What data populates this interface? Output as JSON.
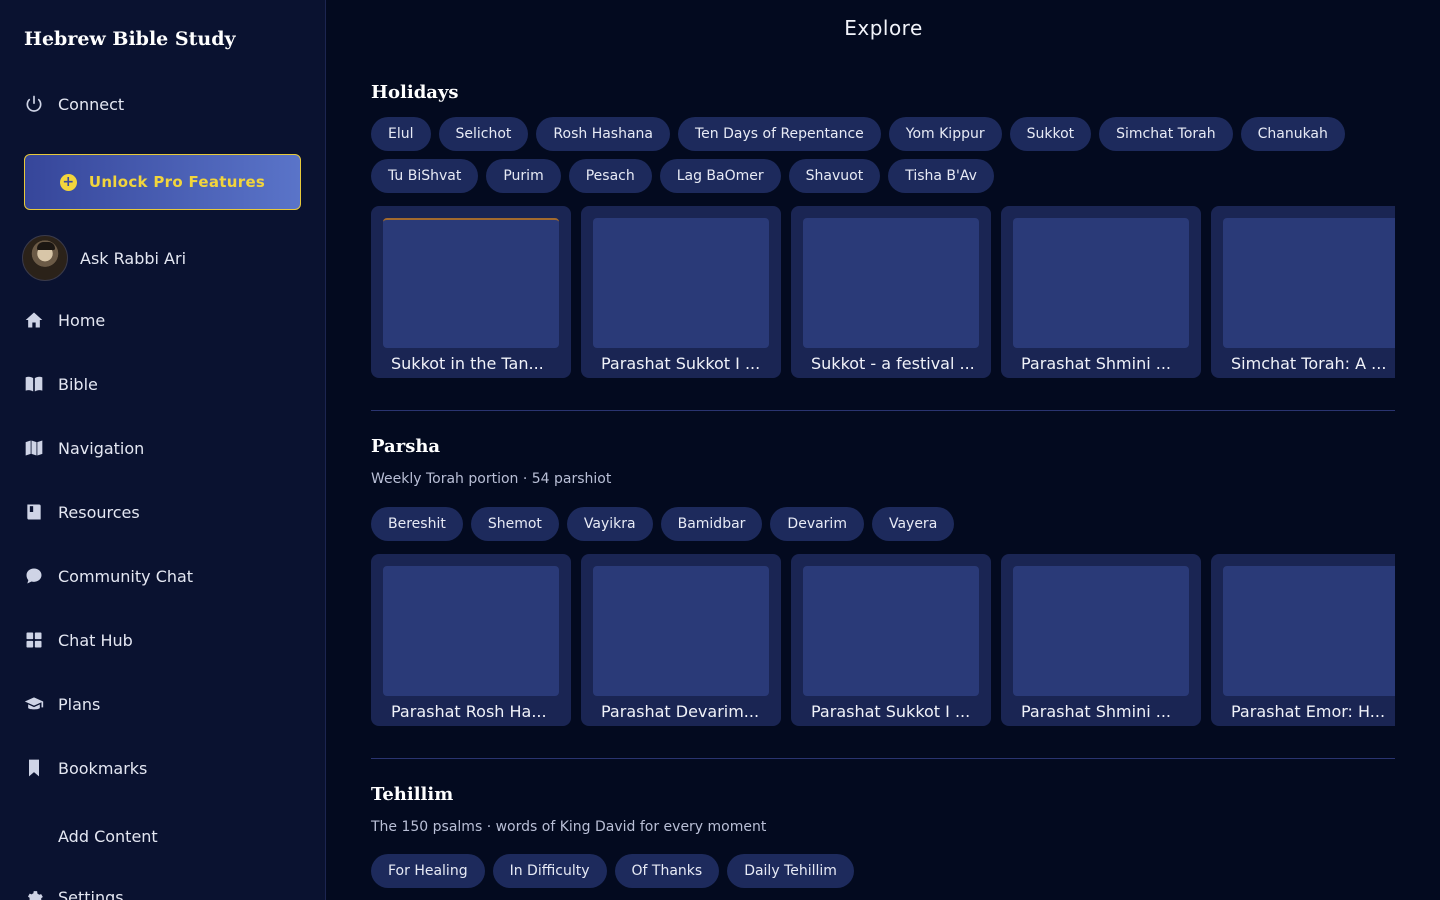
{
  "sidebar": {
    "app_title": "Hebrew Bible Study",
    "connect_label": "Connect",
    "pro_label": "Unlock Pro Features",
    "rabbi_label": "Ask Rabbi Ari",
    "items": [
      {
        "label": "Home",
        "icon": "home-icon"
      },
      {
        "label": "Bible",
        "icon": "book-open-icon"
      },
      {
        "label": "Navigation",
        "icon": "map-icon"
      },
      {
        "label": "Resources",
        "icon": "book-icon"
      },
      {
        "label": "Community Chat",
        "icon": "chat-bubble-icon"
      },
      {
        "label": "Chat Hub",
        "icon": "grid-icon"
      },
      {
        "label": "Plans",
        "icon": "graduation-cap-icon"
      },
      {
        "label": "Bookmarks",
        "icon": "bookmark-icon"
      },
      {
        "label": "Add Content",
        "icon": ""
      },
      {
        "label": "Settings",
        "icon": "gear-icon"
      }
    ]
  },
  "main": {
    "title": "Explore",
    "holidays": {
      "title": "Holidays",
      "pills": [
        "Elul",
        "Selichot",
        "Rosh Hashana",
        "Ten Days of Repentance",
        "Yom Kippur",
        "Sukkot",
        "Simchat Torah",
        "Chanukah",
        "Tu BiShvat",
        "Purim",
        "Pesach",
        "Lag BaOmer",
        "Shavuot",
        "Tisha B'Av"
      ],
      "cards": [
        "Sukkot in the Tan...",
        "Parashat Sukkot I ...",
        "Sukkot - a festival ...",
        "Parashat Shmini ...",
        "Simchat Torah: A ..."
      ]
    },
    "parsha": {
      "title": "Parsha",
      "subtitle": "Weekly Torah portion · 54 parshiot",
      "pills": [
        "Bereshit",
        "Shemot",
        "Vayikra",
        "Bamidbar",
        "Devarim",
        "Vayera"
      ],
      "cards": [
        "Parashat Rosh Ha...",
        "Parashat Devarim...",
        "Parashat Sukkot I ...",
        "Parashat Shmini ...",
        "Parashat Emor: H..."
      ]
    },
    "tehillim": {
      "title": "Tehillim",
      "subtitle": "The 150 psalms · words of King David for every moment",
      "pills": [
        "For Healing",
        "In Difficulty",
        "Of Thanks",
        "Daily Tehillim"
      ]
    }
  },
  "colors": {
    "background": "#030a1f",
    "sidebar": "#0a1230",
    "pill": "#1d2a5c",
    "card": "#1a2553",
    "pro_accent": "#f2d53c"
  }
}
